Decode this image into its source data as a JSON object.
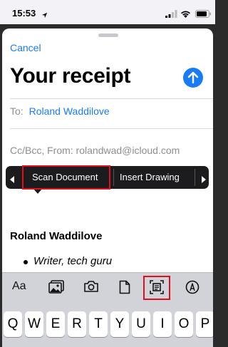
{
  "status_bar": {
    "time": "15:53"
  },
  "compose": {
    "cancel_label": "Cancel",
    "title": "Your receipt",
    "to_label": "To:",
    "to_recipient": "Roland Waddilove",
    "cc_from": "Cc/Bcc, From: rolandwad@icloud.com"
  },
  "edit_menu": {
    "items": [
      {
        "label": "Scan Document",
        "highlighted": true
      },
      {
        "label": "Insert Drawing",
        "highlighted": false
      }
    ]
  },
  "body": {
    "signature_name": "Roland Waddilove",
    "bullet": "Writer, tech guru"
  },
  "format_bar": {
    "text_style_label": "Aa",
    "tools": [
      "photo-library-icon",
      "camera-icon",
      "document-icon",
      "scan-document-icon",
      "markup-icon"
    ]
  },
  "keyboard": {
    "row1": [
      "Q",
      "W",
      "E",
      "R",
      "T",
      "Y",
      "U",
      "I",
      "O",
      "P"
    ]
  },
  "colors": {
    "accent": "#1a7cf5",
    "highlight": "#e0101e",
    "menu_bg": "#1c1c1e",
    "keyboard_bg": "#d1d3d9"
  }
}
